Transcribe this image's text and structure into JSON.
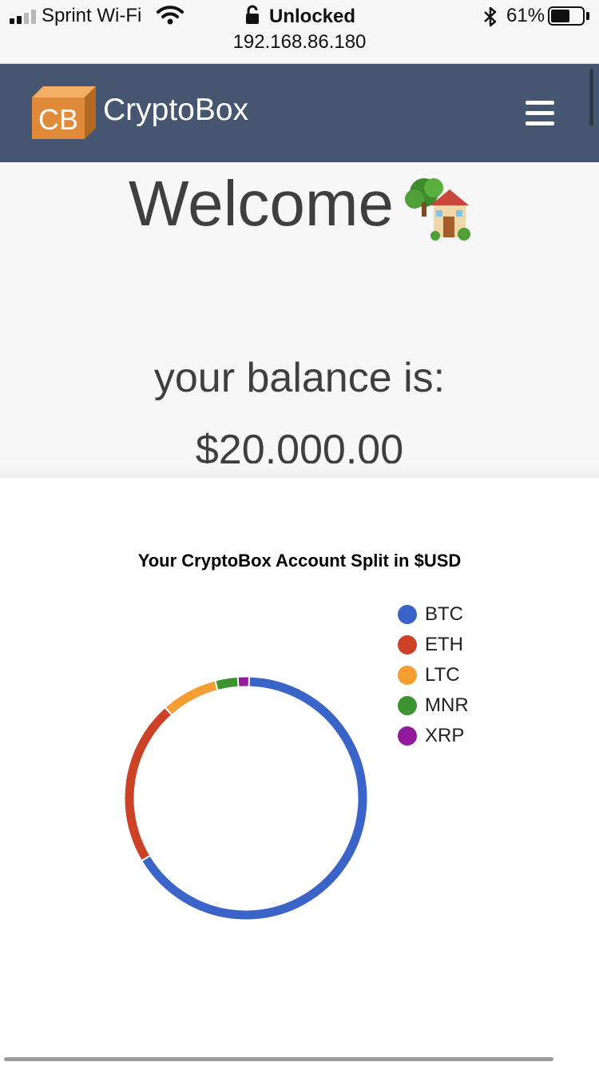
{
  "status_bar": {
    "carrier": "Sprint Wi-Fi",
    "lock_label": "Unlocked",
    "url": "192.168.86.180",
    "battery_percent": "61%",
    "battery_level": 0.61,
    "icons": [
      "signal-icon",
      "wifi-icon",
      "lock-icon",
      "bluetooth-icon",
      "battery-icon"
    ]
  },
  "navbar": {
    "logo_text": "CB",
    "brand": "CryptoBox",
    "menu_icon": "hamburger-menu-icon",
    "bg_color": "#465670"
  },
  "hero": {
    "welcome": "Welcome",
    "welcome_emoji": "house-with-garden-icon",
    "balance_label": "your balance is:",
    "balance_value": "$20,000.00"
  },
  "chart_data": {
    "type": "pie",
    "variant": "donut",
    "title": "Your CryptoBox Account Split in $USD",
    "categories": [
      "BTC",
      "ETH",
      "LTC",
      "MNR",
      "XRP"
    ],
    "values": [
      66,
      22,
      7.5,
      3,
      1.5
    ],
    "colors": [
      "#3b64c8",
      "#cc4226",
      "#f39d32",
      "#3c9430",
      "#921a9c"
    ],
    "legend_position": "right"
  }
}
